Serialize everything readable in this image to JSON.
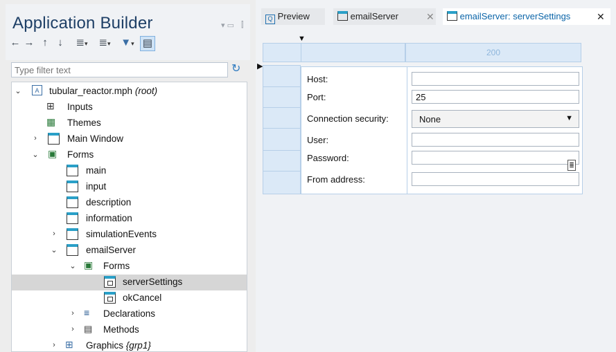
{
  "builder": {
    "title": "Application Builder",
    "filter_placeholder": "Type filter text"
  },
  "toolbar": {
    "icons": [
      "back-arrow",
      "forward-arrow",
      "up-arrow",
      "down-arrow",
      "expand-all",
      "collapse-all",
      "dropdown",
      "link"
    ]
  },
  "tree": {
    "root": {
      "label": "tubular_reactor.mph",
      "suffix": "(root)"
    },
    "inputs": "Inputs",
    "themes": "Themes",
    "main_window": "Main Window",
    "forms": "Forms",
    "form_items": [
      "main",
      "input",
      "description",
      "information",
      "simulationEvents",
      "emailServer"
    ],
    "email_forms": "Forms",
    "server_settings": "serverSettings",
    "ok_cancel": "okCancel",
    "declarations": "Declarations",
    "methods": "Methods",
    "graphics": {
      "label": "Graphics",
      "suffix": "{grp1}"
    }
  },
  "tabs": [
    {
      "label": "Preview",
      "closable": false
    },
    {
      "label": "emailServer",
      "closable": true
    },
    {
      "label": "emailServer: serverSettings",
      "closable": true,
      "active": true
    }
  ],
  "grid": {
    "column_width_label": "200"
  },
  "form": {
    "host": {
      "label": "Host:",
      "value": ""
    },
    "port": {
      "label": "Port:",
      "value": "25"
    },
    "security": {
      "label": "Connection security:",
      "value": "None"
    },
    "user": {
      "label": "User:",
      "value": ""
    },
    "password": {
      "label": "Password:",
      "value": ""
    },
    "from": {
      "label": "From address:",
      "value": ""
    }
  },
  "colors": {
    "accent": "#1e3f66",
    "tab_active": "#0a64a8",
    "grid_blue": "#dbe9f7",
    "selection": "#d6d6d6"
  }
}
